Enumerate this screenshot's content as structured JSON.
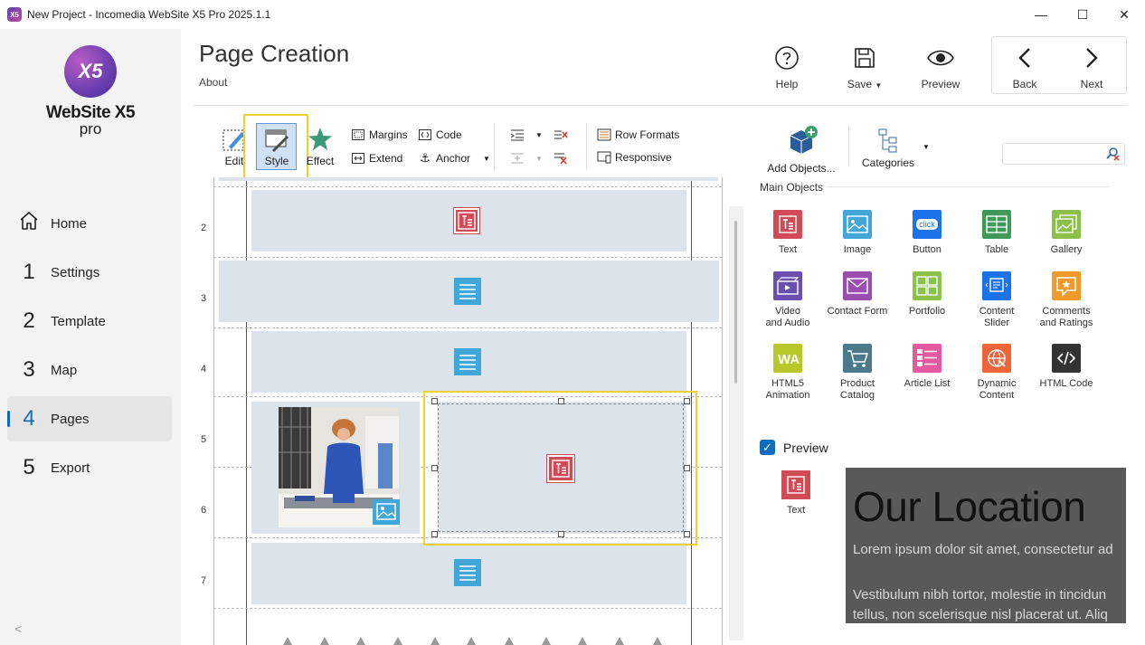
{
  "window": {
    "title": "New Project - Incomedia WebSite X5 Pro 2025.1.1",
    "app_icon": "X5",
    "minimize": "—",
    "maximize": "☐",
    "close": "✕"
  },
  "logo": {
    "mark": "X5",
    "name": "WebSite X5",
    "edition": "pro"
  },
  "nav": {
    "items": [
      {
        "num": "",
        "label": "Home",
        "icon": "home-icon"
      },
      {
        "num": "1",
        "label": "Settings"
      },
      {
        "num": "2",
        "label": "Template"
      },
      {
        "num": "3",
        "label": "Map"
      },
      {
        "num": "4",
        "label": "Pages",
        "active": true
      },
      {
        "num": "5",
        "label": "Export"
      }
    ],
    "collapse": "<"
  },
  "header": {
    "title": "Page Creation",
    "about": "About",
    "help": "Help",
    "save": "Save",
    "preview": "Preview",
    "back": "Back",
    "next": "Next"
  },
  "toolbar": {
    "edit": "Edit",
    "style": "Style",
    "effect": "Effect",
    "margins": "Margins",
    "extend": "Extend",
    "code": "Code",
    "anchor": "Anchor",
    "row_formats": "Row Formats",
    "responsive": "Responsive",
    "add_objects": "Add Objects...",
    "categories": "Categories",
    "search_placeholder": ""
  },
  "canvas": {
    "rows": [
      "2",
      "3",
      "4",
      "5",
      "6",
      "7"
    ]
  },
  "objects_panel": {
    "title": "Main Objects",
    "tiles": [
      {
        "label": "Text",
        "color": "#d04b55"
      },
      {
        "label": "Image",
        "color": "#41a7d8"
      },
      {
        "label": "Button",
        "color": "#1a73e8"
      },
      {
        "label": "Table",
        "color": "#3f9a5a"
      },
      {
        "label": "Gallery",
        "color": "#8cc04b"
      },
      {
        "label": "Video and Audio",
        "color": "#6a4fb0"
      },
      {
        "label": "Contact Form",
        "color": "#9a4fb0"
      },
      {
        "label": "Portfolio",
        "color": "#8cc04b"
      },
      {
        "label": "Content Slider",
        "color": "#1a73e8"
      },
      {
        "label": "Comments and Ratings",
        "color": "#f09a2a"
      },
      {
        "label": "HTML5 Animation",
        "color": "#b7c92a"
      },
      {
        "label": "Product Catalog",
        "color": "#4a7a8a"
      },
      {
        "label": "Article List",
        "color": "#e45aa0"
      },
      {
        "label": "Dynamic Content",
        "color": "#f0643a"
      },
      {
        "label": "HTML Code",
        "color": "#333333"
      }
    ],
    "button_icon_text": "click"
  },
  "preview": {
    "checkbox_label": "Preview",
    "tile_label": "Text",
    "heading": "Our Location",
    "para1": "Lorem ipsum dolor sit amet, consectetur ad",
    "para2": "Vestibulum nibh tortor, molestie in tincidun",
    "para3": "tellus, non scelerisque nisl placerat ut. Aliq"
  }
}
